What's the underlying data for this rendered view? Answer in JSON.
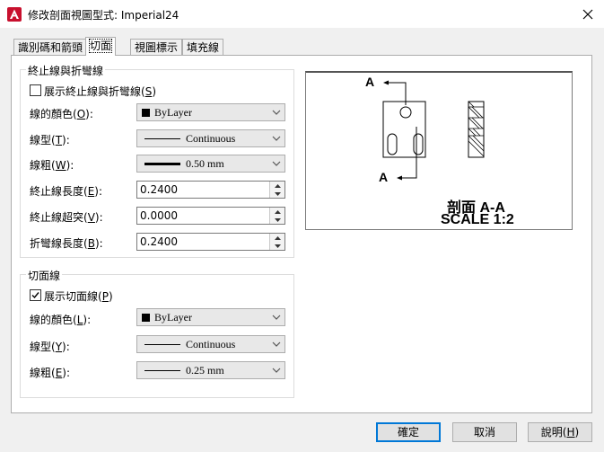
{
  "window": {
    "title": "修改剖面視圖型式: Imperial24"
  },
  "tabs": [
    {
      "label": "識別碼和箭頭"
    },
    {
      "label": "切面"
    },
    {
      "label": "視圖標示"
    },
    {
      "label": "填充線"
    }
  ],
  "end_lines": {
    "group_title": "終止線與折彎線",
    "show_checkbox_label": "展示終止線與折彎線",
    "show_checkbox_key": "S",
    "show_checked": false,
    "color_label": "線的顏色",
    "color_key": "O",
    "color_value": "ByLayer",
    "linetype_label": "線型",
    "linetype_key": "T",
    "linetype_value": "Continuous",
    "lineweight_label": "線粗",
    "lineweight_key": "W",
    "lineweight_value": "0.50 mm",
    "end_length_label": "終止線長度",
    "end_length_key": "E",
    "end_length_value": "0.2400",
    "overshoot_label": "終止線超突",
    "overshoot_key": "V",
    "overshoot_value": "0.0000",
    "bend_length_label": "折彎線長度",
    "bend_length_key": "B",
    "bend_length_value": "0.2400"
  },
  "section_lines": {
    "group_title": "切面線",
    "show_checkbox_label": "展示切面線",
    "show_checkbox_key": "P",
    "show_checked": true,
    "color_label": "線的顏色",
    "color_key": "L",
    "color_value": "ByLayer",
    "linetype_label": "線型",
    "linetype_key": "Y",
    "linetype_value": "Continuous",
    "lineweight_label": "線粗",
    "lineweight_key": "E",
    "lineweight_value": "0.25 mm"
  },
  "preview": {
    "marker_top": "A",
    "marker_bottom": "A",
    "section_label": "剖面 A-A",
    "scale_label": "SCALE 1:2"
  },
  "buttons": {
    "ok": "確定",
    "cancel": "取消",
    "help": "說明",
    "help_key": "H"
  },
  "colors": {
    "accent": "#0078d7",
    "app_icon": "#c8102e"
  }
}
